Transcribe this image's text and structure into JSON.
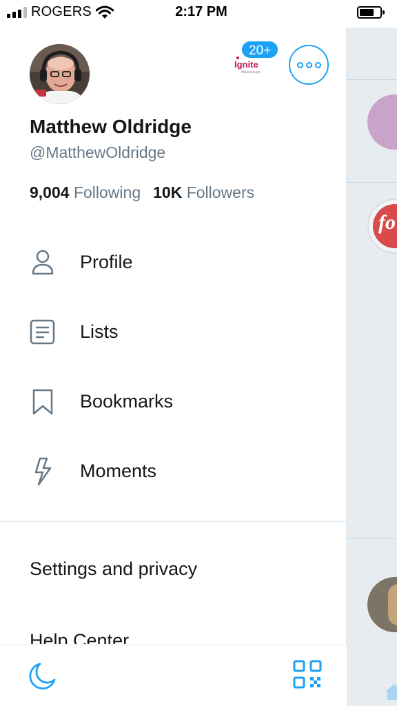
{
  "status_bar": {
    "carrier": "ROGERS",
    "time": "2:17 PM",
    "signal_bars_active": 3,
    "signal_bars_total": 4
  },
  "account": {
    "display_name": "Matthew Oldridge",
    "handle": "@MatthewOldridge",
    "avatar_icon": "profile-photo",
    "switch_account_badge": "20+",
    "switch_account_logo_text": "Ignite",
    "switch_account_logo_subtext": "Mississauga"
  },
  "stats": {
    "following_count": "9,004",
    "following_label": "Following",
    "followers_count": "10K",
    "followers_label": "Followers"
  },
  "menu": [
    {
      "label": "Profile",
      "icon": "person-icon"
    },
    {
      "label": "Lists",
      "icon": "list-icon"
    },
    {
      "label": "Bookmarks",
      "icon": "bookmark-icon"
    },
    {
      "label": "Moments",
      "icon": "lightning-icon"
    }
  ],
  "secondary_menu": {
    "settings_label": "Settings and privacy",
    "help_label": "Help Center"
  },
  "footer": {
    "night_mode_icon": "moon-icon",
    "qr_icon": "qr-code-icon"
  },
  "colors": {
    "accent": "#1da1f2",
    "text_primary": "#14171a",
    "text_secondary": "#657786",
    "background_peek": "#e6ecf0"
  }
}
